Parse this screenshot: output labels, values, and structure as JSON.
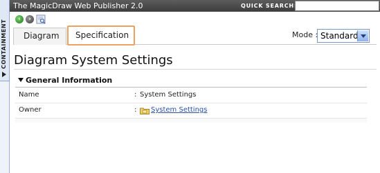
{
  "rail": {
    "label": "CONTAINMENT"
  },
  "header": {
    "title": "The MagicDraw Web Publisher 2.0",
    "quick_search_label": "QUICK SEARCH:",
    "quick_search_value": ""
  },
  "toolbar": {
    "icons": [
      "back-arrow-icon",
      "forward-arrow-icon",
      "find-icon"
    ]
  },
  "tabs": [
    {
      "label": "Diagram",
      "active": false
    },
    {
      "label": "Specification",
      "active": true
    }
  ],
  "mode": {
    "label": "Mode :",
    "selected": "Standard"
  },
  "page": {
    "title": "Diagram System Settings"
  },
  "section": {
    "title": "General Information",
    "rows": [
      {
        "label": "Name",
        "value": "System Settings"
      },
      {
        "label": "Owner",
        "value": "System Settings",
        "icon": "package-folder-icon"
      }
    ]
  },
  "colors": {
    "titlebar": "#4a4a4a",
    "active_tab_highlight": "#f0a060",
    "link": "#2a4fa8",
    "back_button": "#2e9a2a"
  }
}
